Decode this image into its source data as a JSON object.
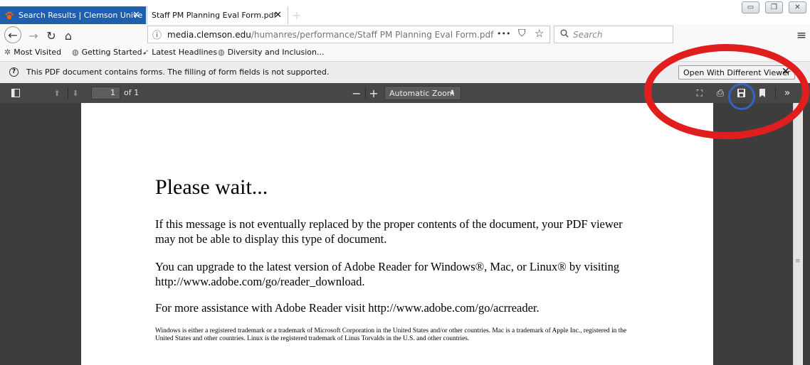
{
  "tabs": [
    {
      "label": "Search Results | Clemson Unive",
      "close": "✕",
      "state": "background"
    },
    {
      "label": "Staff PM Planning Eval Form.pdf",
      "close": "✕",
      "state": "active"
    }
  ],
  "new_tab": "+",
  "window_buttons": {
    "minimize": "▭",
    "restore": "❐",
    "close": "✕"
  },
  "nav": {
    "back": "←",
    "forward": "→",
    "reload": "↻",
    "home": "⌂",
    "url_info": "ⓘ",
    "url_host": "media.clemson.edu",
    "url_prefix": "",
    "url_path": "/humanres/performance/Staff PM Planning Eval Form.pdf",
    "url_actions": {
      "more": "•••",
      "pocket": "⛉",
      "bookmark": "☆"
    },
    "search_placeholder": "Search",
    "menu": "≡"
  },
  "bookmarks": [
    {
      "label": "Most Visited",
      "icon": "gear-icon"
    },
    {
      "label": "Getting Started",
      "icon": "globe-icon"
    },
    {
      "label": "Latest Headlines",
      "icon": "rss-icon"
    },
    {
      "label": "Diversity and Inclusion...",
      "icon": "globe-icon"
    }
  ],
  "notification": {
    "icon": "?",
    "text": "This PDF document contains forms. The filling of form fields is not supported.",
    "button_label": "Open With Different Viewer",
    "close": "✕"
  },
  "pdf_toolbar": {
    "sidebar_toggle": "◫",
    "prev_page": "⬆",
    "next_page": "⬇",
    "page_number": "1",
    "page_count": "of 1",
    "zoom_out": "−",
    "zoom_in": "+",
    "zoom_value": "Automatic Zoom",
    "zoom_arrows": "⬍",
    "presentation": "⛶",
    "print": "⎙",
    "save": "🖫",
    "bookmark": "▮",
    "tools": "»"
  },
  "document": {
    "heading": "Please wait...",
    "paragraph1": "If this message is not eventually replaced by the proper contents of the document, your PDF viewer may not be able to display this type of document.",
    "paragraph2": "You can upgrade to the latest version of Adobe Reader for Windows®, Mac, or Linux® by visiting  http://www.adobe.com/go/reader_download.",
    "paragraph3": "For more assistance with Adobe Reader visit  http://www.adobe.com/go/acrreader.",
    "footnote": "Windows is either a registered trademark or a trademark of Microsoft Corporation in the United States and/or other countries. Mac is a trademark of Apple Inc., registered in the United States and other countries. Linux is the registered trademark of Linus Torvalds in the U.S. and other countries."
  },
  "colors": {
    "tab_background": "#1f5fae",
    "pdf_toolbar": "#474747",
    "viewer_background": "#3d3d3d",
    "annotation_red": "#e01e1e",
    "annotation_blue": "#3662c9"
  }
}
